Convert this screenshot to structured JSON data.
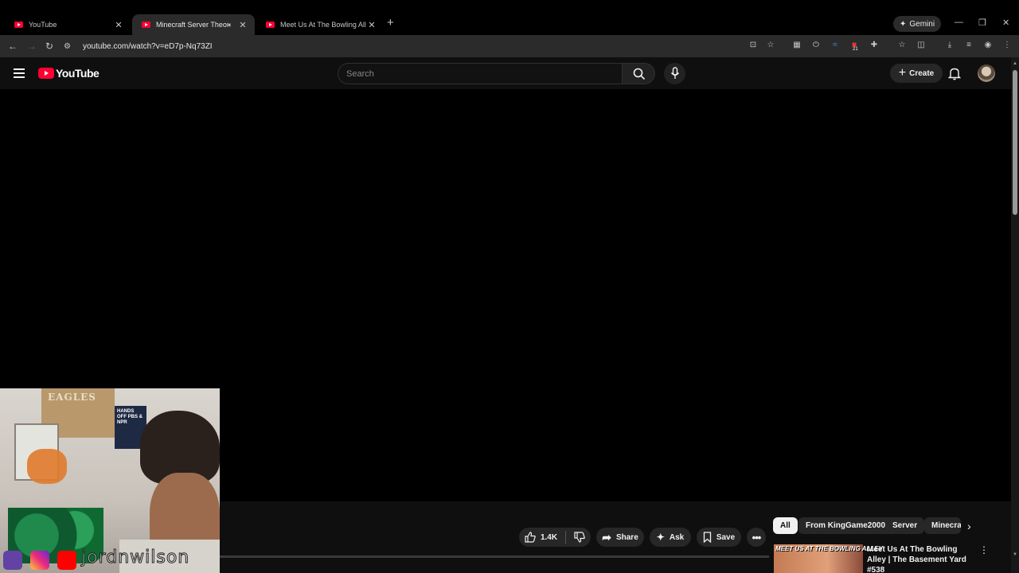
{
  "browser": {
    "tabs": [
      {
        "title": "YouTube",
        "active": false
      },
      {
        "title": "Minecraft Server Theory - Y",
        "active": true
      },
      {
        "title": "Meet Us At The Bowling Alley |",
        "active": false
      }
    ],
    "new_tab_glyph": "+",
    "gemini_label": "Gemini",
    "url": "youtube.com/watch?v=eD7p-Nq73ZI",
    "extension_badge": "21"
  },
  "youtube": {
    "logo_text": "YouTube",
    "search_placeholder": "Search",
    "create_label": "Create",
    "actions": {
      "likes": "1.4K",
      "share": "Share",
      "ask": "Ask",
      "save": "Save"
    },
    "chips": [
      "All",
      "From KingGame2000",
      "Server",
      "Minecra"
    ],
    "recommendation": {
      "thumbnail_text": "MEET US AT THE BOWLING ALLEY",
      "title": "Meet Us At The Bowling Alley | The Basement Yard #538"
    }
  },
  "webcam": {
    "banner_text": "EAGLES",
    "sign_text": "HANDS OFF PBS & NPR",
    "streamer_name": "jordnwilson"
  },
  "colors": {
    "yt_red": "#ff0033",
    "background": "#0f0f0f",
    "chip_selected": "#f1f1f1"
  }
}
